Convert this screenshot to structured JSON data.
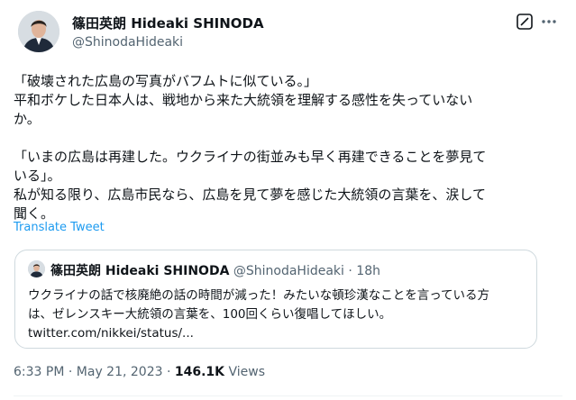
{
  "author": {
    "name": "篠田英朗 Hideaki SHINODA",
    "handle": "@ShinodaHideaki",
    "avatar_icon": "person-avatar-icon"
  },
  "header_actions": [
    "grok-icon",
    "more-options-icon"
  ],
  "tweet": {
    "text": "「破壊された広島の写真がバフムトに似ている。」\n平和ボケした日本人は、戦地から来た大統領を理解する感性を失っていない\nか。\n\n「いまの広島は再建した。ウクライナの街並みも早く再建できることを夢見て\nいる」。\n私が知る限り、広島市民なら、広島を見て夢を感じた大統領の言葉を、涙して\n聞く。",
    "translate_label": "Translate Tweet"
  },
  "quote": {
    "name": "篠田英朗 Hideaki SHINODA",
    "handle": "@ShinodaHideaki",
    "separator": "·",
    "time": "18h",
    "text": "ウクライナの話で核廃絶の話の時間が減った！みたいな頓珍漢なことを言っている方\nは、ゼレンスキー大統領の言葉を、100回くらい復唱してほしい。\ntwitter.com/nikkei/status/..."
  },
  "footer": {
    "time": "6:33 PM",
    "separator": "·",
    "date": "May 21, 2023",
    "views_count": "146.1K",
    "views_label": "Views"
  },
  "colors": {
    "link": "#1d9bf0",
    "secondary_text": "#536471",
    "border": "#cfd9de"
  }
}
